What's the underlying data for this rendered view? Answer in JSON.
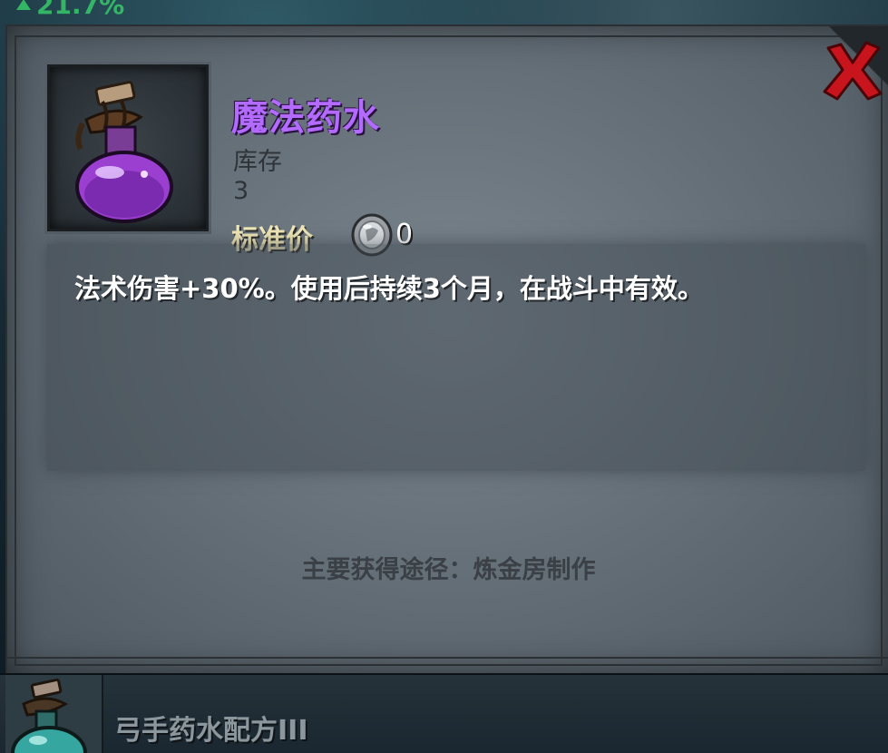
{
  "header": {
    "stat_text": "21.7%",
    "stat_color": "#38c96a"
  },
  "item": {
    "name": "魔法药水",
    "name_color": "#b36bff",
    "icon": "purple-potion-icon",
    "stock_label": "库存",
    "stock_value": "3",
    "price_label": "标准价",
    "price_icon": "silver-coin-icon",
    "price_value": "0",
    "description": "法术伤害+30%。使用后持续3个月，在战斗中有效。",
    "source": "主要获得途径：炼金房制作"
  },
  "close": {
    "icon": "close-x-icon",
    "color": "#c8141c"
  },
  "list": {
    "items": [
      {
        "label": "弓手药水配方III",
        "icon": "teal-potion-icon"
      }
    ]
  }
}
